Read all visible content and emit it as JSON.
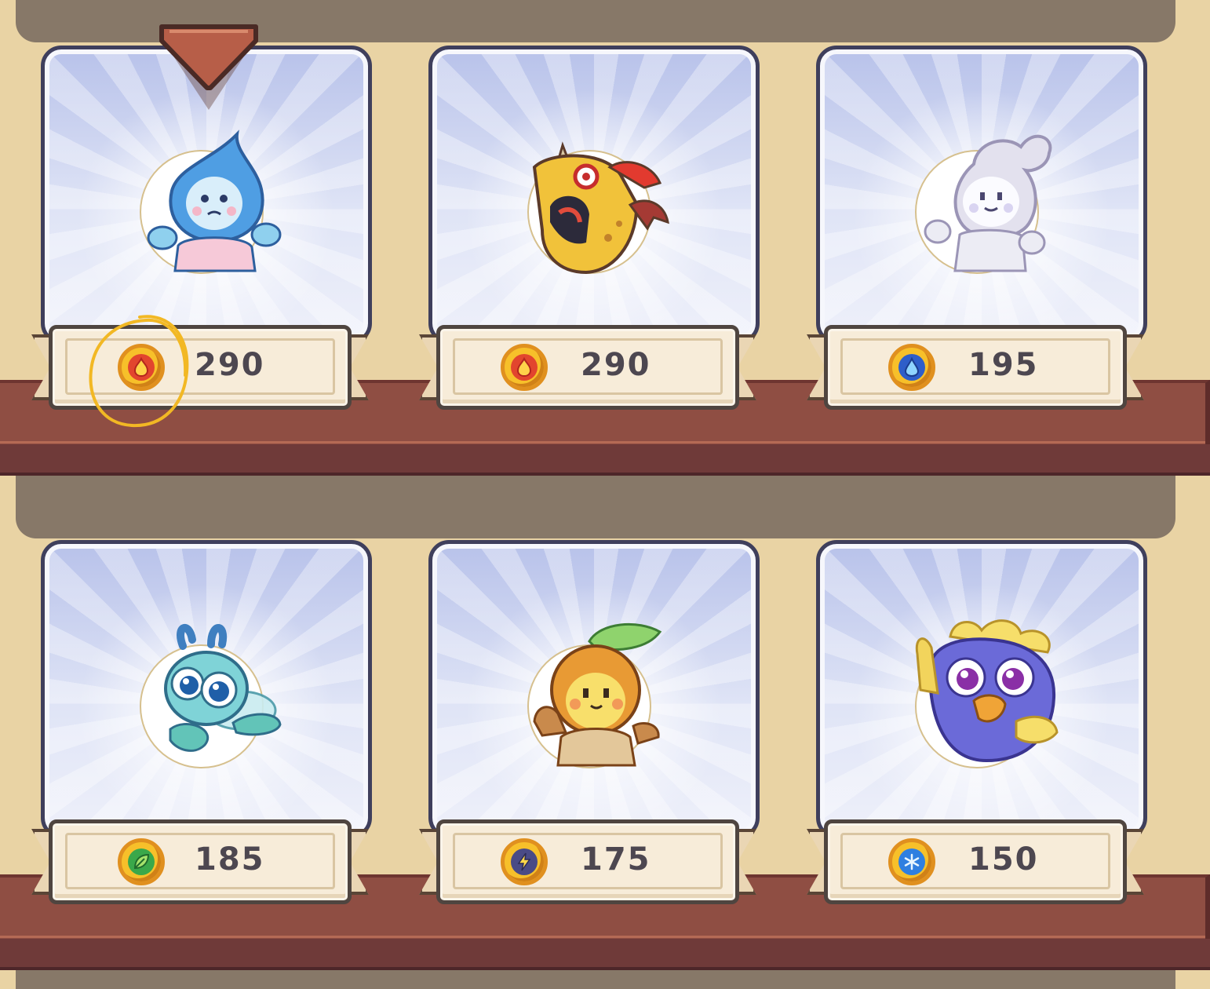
{
  "colors": {
    "wall": "#ecd6a9",
    "back_panel": "#877868",
    "shelf": "#8f4e43",
    "card_border": "#3f3f5c",
    "price_text": "#4d4750",
    "annotation_circle": "#f2b824"
  },
  "shop": {
    "rows": [
      {
        "items": [
          {
            "price": "290",
            "currency": "fire",
            "currency_icon": "fire-coin-icon",
            "creature": "water-drop-creature",
            "selected": true,
            "annotated": true
          },
          {
            "price": "290",
            "currency": "fire",
            "currency_icon": "fire-coin-icon",
            "creature": "fire-dragon-creature",
            "selected": false,
            "annotated": false
          },
          {
            "price": "195",
            "currency": "water",
            "currency_icon": "water-coin-icon",
            "creature": "cloud-creature",
            "selected": false,
            "annotated": false
          }
        ]
      },
      {
        "items": [
          {
            "price": "185",
            "currency": "plant",
            "currency_icon": "leaf-coin-icon",
            "creature": "dragonfly-creature",
            "selected": false,
            "annotated": false
          },
          {
            "price": "175",
            "currency": "storm",
            "currency_icon": "lightning-coin-icon",
            "creature": "leaf-sprout-creature",
            "selected": false,
            "annotated": false
          },
          {
            "price": "150",
            "currency": "ice",
            "currency_icon": "snowflake-coin-icon",
            "creature": "blue-bird-creature",
            "selected": false,
            "annotated": false
          }
        ]
      }
    ]
  }
}
